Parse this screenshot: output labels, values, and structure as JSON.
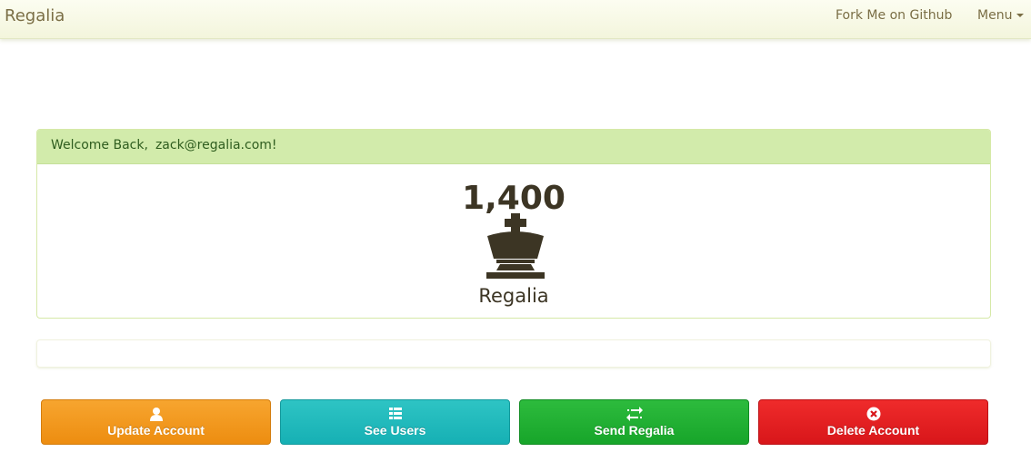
{
  "navbar": {
    "brand": "Regalia",
    "fork_label": "Fork Me on Github",
    "menu_label": "Menu"
  },
  "panel": {
    "welcome_prefix": "Welcome Back,",
    "email": "zack@regalia.com!",
    "balance": "1,400",
    "currency": "Regalia",
    "currency_icon": "chess-king-icon"
  },
  "actions": {
    "update": {
      "label": "Update Account",
      "icon": "user-icon"
    },
    "users": {
      "label": "See Users",
      "icon": "list-icon"
    },
    "send": {
      "label": "Send Regalia",
      "icon": "transfer-icon"
    },
    "delete": {
      "label": "Delete Account",
      "icon": "remove-circle-icon"
    }
  },
  "colors": {
    "update": "#f39c1f",
    "users": "#20b9bb",
    "send": "#22b034",
    "delete": "#e3211f",
    "panel_heading": "#d2ebab"
  }
}
